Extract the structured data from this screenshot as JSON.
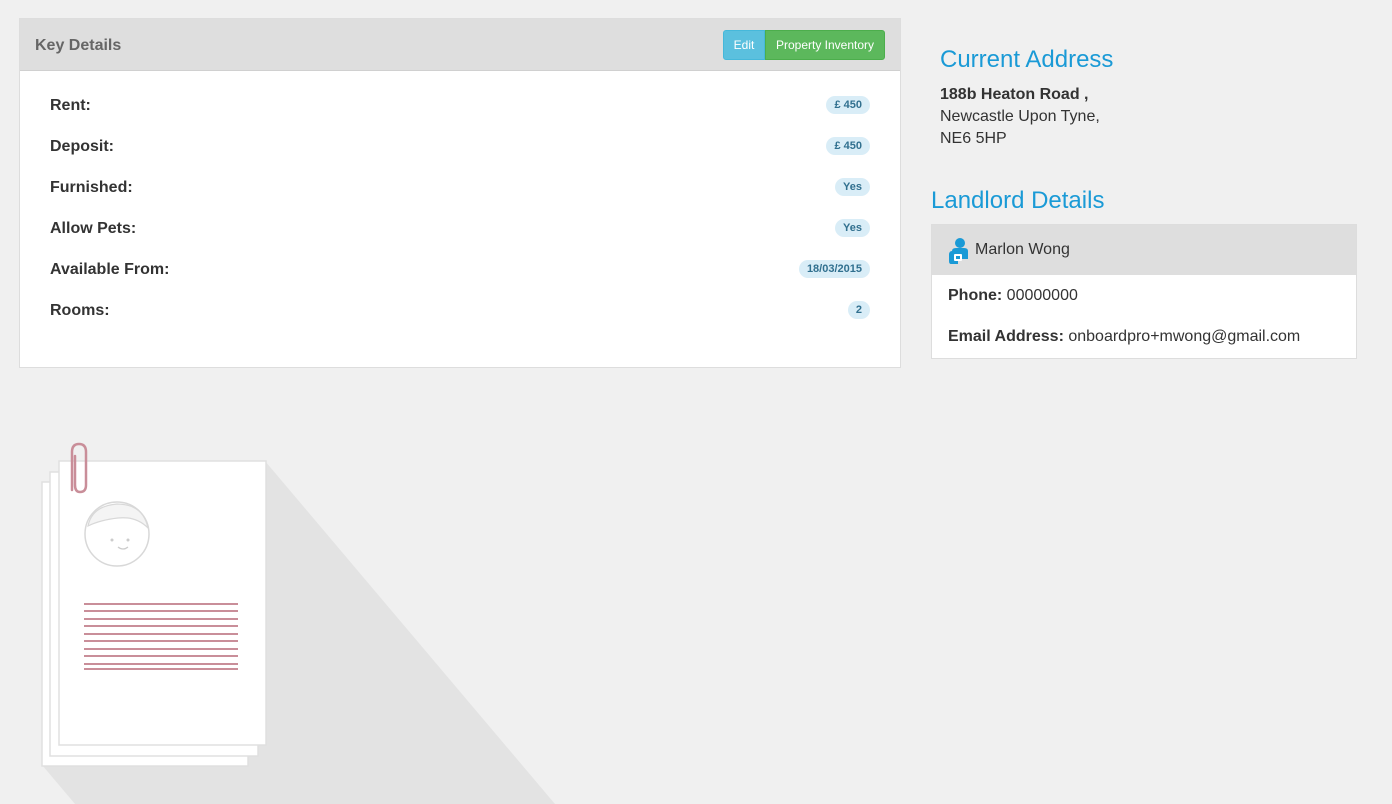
{
  "key_details": {
    "title": "Key Details",
    "edit_label": "Edit",
    "inventory_label": "Property Inventory",
    "rows": [
      {
        "label": "Rent:",
        "value": "£ 450"
      },
      {
        "label": "Deposit:",
        "value": "£ 450"
      },
      {
        "label": "Furnished:",
        "value": "Yes"
      },
      {
        "label": "Allow Pets:",
        "value": "Yes"
      },
      {
        "label": "Available From:",
        "value": "18/03/2015"
      },
      {
        "label": "Rooms:",
        "value": "2"
      }
    ]
  },
  "current_address": {
    "title": "Current Address",
    "street": "188b Heaton Road ,",
    "city": "Newcastle Upon Tyne,",
    "postcode": "NE6 5HP"
  },
  "landlord": {
    "title": "Landlord Details",
    "name": "Marlon Wong",
    "phone_label": "Phone:",
    "phone": "00000000",
    "email_label": "Email Address:",
    "email": "onboardpro+mwong@gmail.com"
  },
  "colors": {
    "accent": "#1a9ad6",
    "edit": "#5bc0de",
    "inventory": "#5cb85c",
    "badge_bg": "#d9edf7",
    "badge_text": "#31708f"
  },
  "icons": {
    "landlord": "person-icon",
    "illustration": "document-stack-illustration"
  }
}
